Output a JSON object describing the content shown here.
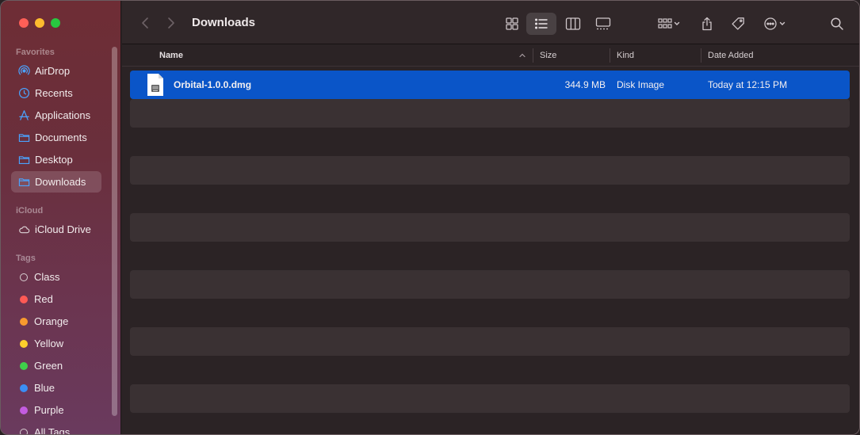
{
  "window": {
    "title": "Downloads"
  },
  "sidebar": {
    "sections": [
      {
        "label": "Favorites"
      },
      {
        "label": "iCloud"
      },
      {
        "label": "Tags"
      }
    ],
    "favorites": [
      {
        "label": "AirDrop",
        "icon": "airdrop-icon"
      },
      {
        "label": "Recents",
        "icon": "clock-icon"
      },
      {
        "label": "Applications",
        "icon": "applications-icon"
      },
      {
        "label": "Documents",
        "icon": "folder-icon"
      },
      {
        "label": "Desktop",
        "icon": "folder-icon"
      },
      {
        "label": "Downloads",
        "icon": "folder-icon",
        "active": true
      }
    ],
    "icloud": [
      {
        "label": "iCloud Drive",
        "icon": "cloud-icon"
      }
    ],
    "tags": [
      {
        "label": "Class",
        "color": ""
      },
      {
        "label": "Red",
        "color": "#fe5a55"
      },
      {
        "label": "Orange",
        "color": "#f89a2e"
      },
      {
        "label": "Yellow",
        "color": "#fdcf2c"
      },
      {
        "label": "Green",
        "color": "#3fcf4a"
      },
      {
        "label": "Blue",
        "color": "#3b8ef5"
      },
      {
        "label": "Purple",
        "color": "#c35ce0"
      },
      {
        "label": "All Tags...",
        "color": ""
      }
    ]
  },
  "toolbar": {
    "buttons": [
      "back-icon",
      "forward-icon",
      "icon-view-icon",
      "list-view-icon",
      "column-view-icon",
      "gallery-view-icon",
      "group-icon",
      "share-icon",
      "tag-icon",
      "more-actions-icon",
      "search-icon"
    ],
    "selected_view": "list-view-icon"
  },
  "columns": {
    "name": "Name",
    "size": "Size",
    "kind": "Kind",
    "date_added": "Date Added"
  },
  "files": [
    {
      "name": "Orbital-1.0.0.dmg",
      "size": "344.9 MB",
      "kind": "Disk Image",
      "date_added": "Today at 12:15 PM",
      "selected": true
    }
  ],
  "colors": {
    "selection": "#0a55c8",
    "accent_icon": "#4aa3ff"
  }
}
